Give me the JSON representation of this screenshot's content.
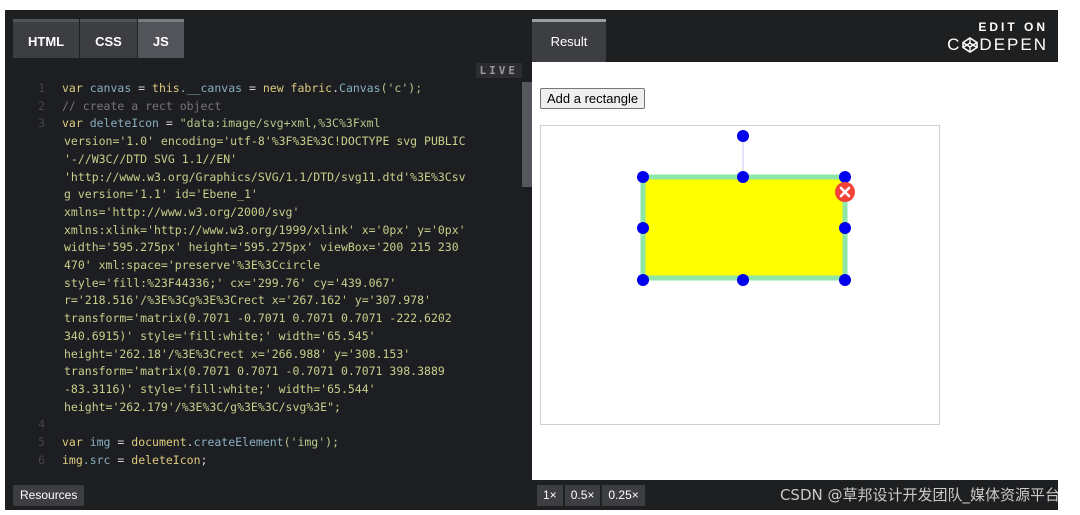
{
  "tabs": [
    "HTML",
    "CSS",
    "JS"
  ],
  "result_tab": "Result",
  "codepen": {
    "edit_on": "EDIT ON",
    "brand": "C",
    "brand_rest": "DEPEN"
  },
  "editor": {
    "live": "LIVE",
    "line_numbers": [
      "1",
      "2",
      "3",
      "4",
      "5",
      "6"
    ]
  },
  "code": {
    "l1": [
      "var",
      " canvas ",
      "=",
      " this",
      ".__canvas ",
      "=",
      " new",
      " fabric",
      ".",
      "Canvas",
      "('c');"
    ],
    "l2": "// create a rect object",
    "l3_parts": [
      "var",
      " deleteIcon ",
      "=",
      " \"data:image/svg+xml,%3C%3Fxml"
    ],
    "l3_wrap": [
      "version='1.0' encoding='utf-8'%3F%3E%3C!DOCTYPE svg PUBLIC",
      "'-//W3C//DTD SVG 1.1//EN'",
      "'http://www.w3.org/Graphics/SVG/1.1/DTD/svg11.dtd'%3E%3Csv",
      "g version='1.1' id='Ebene_1'",
      "xmlns='http://www.w3.org/2000/svg'",
      "xmlns:xlink='http://www.w3.org/1999/xlink' x='0px' y='0px'",
      "width='595.275px' height='595.275px' viewBox='200 215 230",
      "470' xml:space='preserve'%3E%3Ccircle",
      "style='fill:%23F44336;' cx='299.76' cy='439.067'",
      "r='218.516'/%3E%3Cg%3E%3Crect x='267.162' y='307.978'",
      "transform='matrix(0.7071 -0.7071 0.7071 0.7071 -222.6202",
      "340.6915)' style='fill:white;' width='65.545'",
      "height='262.18'/%3E%3Crect x='266.988' y='308.153'",
      "transform='matrix(0.7071 0.7071 -0.7071 0.7071 398.3889",
      "-83.3116)' style='fill:white;' width='65.544'",
      "height='262.179'/%3E%3C/g%3E%3C/svg%3E\";"
    ],
    "l5": [
      "var",
      " img ",
      "=",
      " document",
      ".",
      "createElement",
      "('img');"
    ],
    "l6": [
      "img",
      ".src ",
      "=",
      " deleteIcon",
      ";"
    ]
  },
  "result": {
    "add_button": "Add a rectangle",
    "rect_fill": "#ffff00",
    "rect_border": "#8ee6a8",
    "handle_color": "#0000ee",
    "delete_icon_color": "#f44336"
  },
  "bottom": {
    "resources": "Resources",
    "zooms": [
      "1×",
      "0.5×",
      "0.25×"
    ],
    "watermark": "CSDN @草邦设计开发团队_媒体资源平台"
  }
}
